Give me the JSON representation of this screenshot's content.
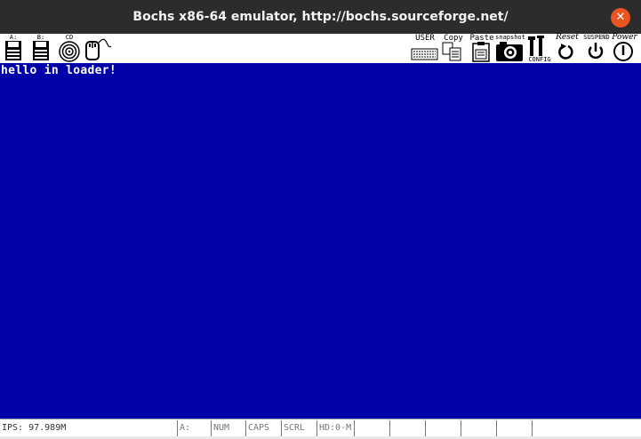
{
  "window": {
    "title": "Bochs x86-64 emulator, http://bochs.sourceforge.net/",
    "close_glyph": "✕",
    "accent_color": "#e95420"
  },
  "toolbar": {
    "floppy_a_label": "A:",
    "floppy_b_label": "B:",
    "cdrom_label": "CD",
    "user_label": "USER",
    "copy_label": "Copy",
    "paste_label": "Paste",
    "snapshot_label": "snapshot",
    "config_label": "CONFIG",
    "reset_label": "Reset",
    "suspend_label": "SUSPEND",
    "power_label": "Power"
  },
  "screen": {
    "background": "#0000a8",
    "lines": [
      "hello in loader!"
    ]
  },
  "statusbar": {
    "ips": "IPS: 97.989M",
    "floppy": "A:",
    "num": "NUM",
    "caps": "CAPS",
    "scrl": "SCRL",
    "hd": "HD:0-M"
  }
}
